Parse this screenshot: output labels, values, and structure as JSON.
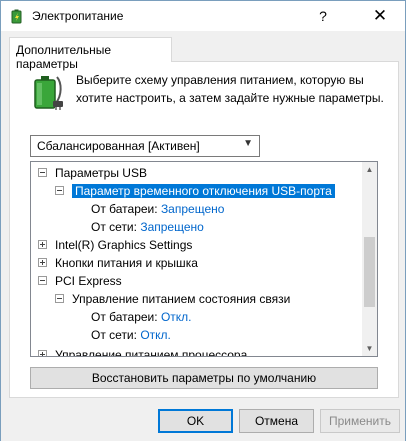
{
  "window": {
    "title": "Электропитание",
    "help": "?",
    "close": "✕"
  },
  "tab": {
    "label": "Дополнительные параметры"
  },
  "description": "Выберите схему управления питанием, которую вы хотите настроить, а затем задайте нужные параметры.",
  "scheme_select": {
    "value": "Сбалансированная [Активен]"
  },
  "tree": {
    "usb": "Параметры USB",
    "usb_suspend": "Параметр временного отключения USB-порта",
    "on_battery_label": "От батареи:",
    "on_battery_value_usb": "Запрещено",
    "plugged_in_label": "От сети:",
    "plugged_in_value_usb": "Запрещено",
    "intel_graphics": "Intel(R) Graphics Settings",
    "power_buttons": "Кнопки питания и крышка",
    "pci_express": "PCI Express",
    "link_state": "Управление питанием состояния связи",
    "on_battery_value_pci": "Откл.",
    "plugged_in_value_pci": "Откл.",
    "cpu_power": "Управление питанием процессора"
  },
  "buttons": {
    "restore": "Восстановить параметры по умолчанию",
    "ok": "OK",
    "cancel": "Отмена",
    "apply": "Применить"
  },
  "colors": {
    "accent": "#0078d7",
    "link": "#0066cc",
    "window_bg": "#f0f0f0"
  }
}
